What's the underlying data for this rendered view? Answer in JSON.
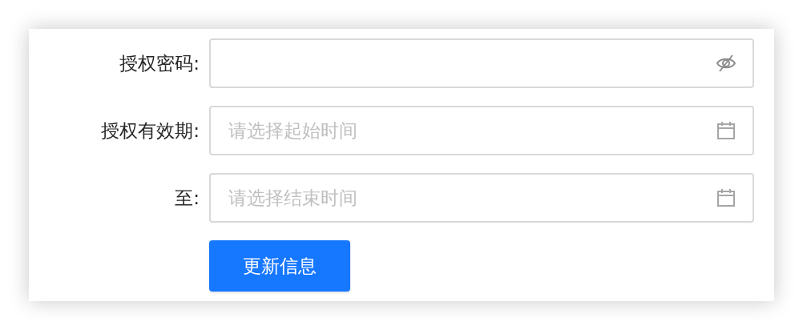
{
  "form": {
    "fields": [
      {
        "label": "授权密码:",
        "kind": "password"
      },
      {
        "label": "授权有效期:",
        "kind": "date",
        "placeholder": "请选择起始时间"
      },
      {
        "label": "至:",
        "kind": "date",
        "placeholder": "请选择结束时间"
      }
    ],
    "submit": "更新信息"
  }
}
